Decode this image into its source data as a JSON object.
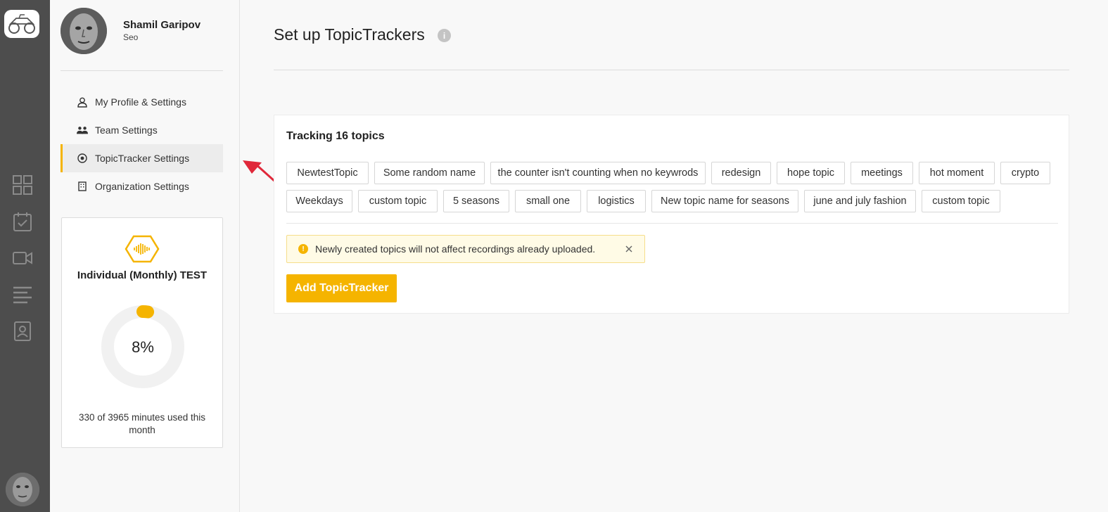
{
  "user": {
    "name": "Shamil Garipov",
    "role": "Seo"
  },
  "menu": {
    "items": [
      {
        "label": "My Profile & Settings",
        "icon": "user-icon"
      },
      {
        "label": "Team Settings",
        "icon": "team-icon"
      },
      {
        "label": "TopicTracker Settings",
        "icon": "target-icon",
        "active": true
      },
      {
        "label": "Organization Settings",
        "icon": "building-icon"
      }
    ]
  },
  "plan": {
    "name": "Individual (Monthly) TEST",
    "percent_label": "8%",
    "usage_fraction": 0.08,
    "usage_text": "330 of 3965 minutes used this month"
  },
  "page": {
    "title": "Set up TopicTrackers",
    "info_icon": "i"
  },
  "tracking": {
    "title": "Tracking 16 topics",
    "topics": [
      "NewtestTopic",
      "Some random name",
      "the counter isn't counting when no keywrods",
      "redesign",
      "hope topic",
      "meetings",
      "hot moment",
      "crypto",
      "Weekdays",
      "custom topic",
      "5 seasons",
      "small one",
      "logistics",
      "New topic name for seasons",
      "june and july fashion",
      "custom topic"
    ]
  },
  "notice": {
    "text": "Newly created topics will not affect recordings already uploaded."
  },
  "actions": {
    "add_label": "Add TopicTracker"
  },
  "colors": {
    "accent": "#f5b400",
    "rail": "#4d4d4d",
    "annotation_arrow": "#e0283a"
  }
}
